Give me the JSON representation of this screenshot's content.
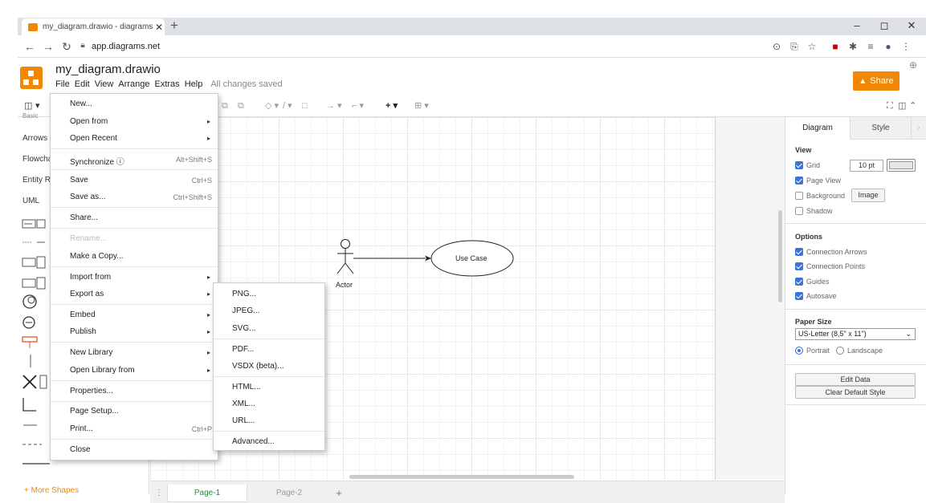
{
  "browser": {
    "tab_title": "my_diagram.drawio - diagrams.n",
    "tab_close": "✕",
    "new_tab": "+",
    "url": "app.diagrams.net",
    "window": {
      "minimize": "–",
      "restore": "◻",
      "close": "✕"
    }
  },
  "app": {
    "title": "my_diagram.drawio",
    "menu": [
      "File",
      "Edit",
      "View",
      "Arrange",
      "Extras",
      "Help"
    ],
    "save_status": "All changes saved",
    "share_label": "Share",
    "accent": "#f08705"
  },
  "toolbar": {
    "format_toggle": "▾",
    "items": [
      "⧉",
      "⧉",
      "◇ ▾",
      "/ ▾",
      "□",
      "→ ▾",
      "⌐ ▾",
      "+ ▾",
      "⊞ ▾"
    ],
    "right_icons": [
      "⛶",
      "◫",
      "⌃"
    ]
  },
  "sidebar": {
    "categories": [
      "Basic",
      "Arrows",
      "Flowchart",
      "Entity Relation",
      "UML"
    ],
    "more_shapes": "+ More Shapes"
  },
  "diagram": {
    "actor_label": "Actor",
    "usecase_label": "Use Case"
  },
  "pages": {
    "tabs": [
      "Page-1",
      "Page-2"
    ],
    "active": "Page-1",
    "menu_icon": "⋮",
    "add": "+"
  },
  "format_panel": {
    "tabs": [
      "Diagram",
      "Style"
    ],
    "view_title": "View",
    "grid_label": "Grid",
    "grid_size": "10 pt",
    "page_view_label": "Page View",
    "background_label": "Background",
    "image_button": "Image",
    "shadow_label": "Shadow",
    "options_title": "Options",
    "connection_arrows": "Connection Arrows",
    "connection_points": "Connection Points",
    "guides": "Guides",
    "autosave": "Autosave",
    "paper_size_title": "Paper Size",
    "paper_size_value": "US-Letter (8,5\" x 11\")",
    "portrait": "Portrait",
    "landscape": "Landscape",
    "edit_data": "Edit Data",
    "clear_default_style": "Clear Default Style"
  },
  "file_menu": {
    "items": [
      {
        "label": "New..."
      },
      {
        "label": "Open from"
      },
      {
        "label": "Open Recent"
      },
      {
        "label": "Synchronize ⓘ",
        "shortcut": "Alt+Shift+S"
      },
      {
        "label": "Save",
        "shortcut": "Ctrl+S"
      },
      {
        "label": "Save as...",
        "shortcut": "Ctrl+Shift+S"
      },
      {
        "label": "Share..."
      },
      {
        "label": "Rename..."
      },
      {
        "label": "Make a Copy..."
      },
      {
        "label": "Import from"
      },
      {
        "label": "Export as"
      },
      {
        "label": "Embed"
      },
      {
        "label": "Publish"
      },
      {
        "label": "New Library"
      },
      {
        "label": "Open Library from"
      },
      {
        "label": "Properties..."
      },
      {
        "label": "Page Setup..."
      },
      {
        "label": "Print...",
        "shortcut": "Ctrl+P"
      },
      {
        "label": "Close"
      }
    ]
  },
  "export_submenu": {
    "items": [
      "PNG...",
      "JPEG...",
      "SVG...",
      "PDF...",
      "VSDX (beta)...",
      "HTML...",
      "XML...",
      "URL...",
      "Advanced..."
    ]
  }
}
